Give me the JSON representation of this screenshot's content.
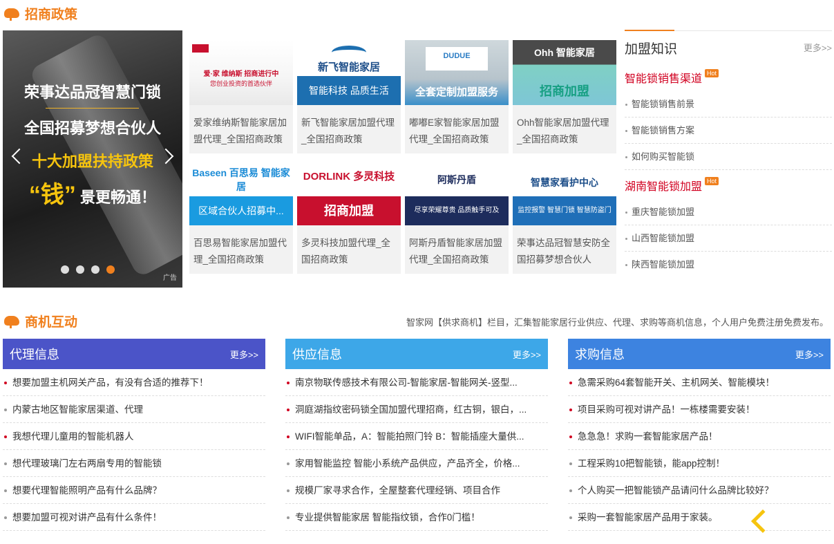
{
  "section1": {
    "title": "招商政策"
  },
  "banner": {
    "line1": "荣事达品冠智慧门锁",
    "line2": "全国招募梦想合伙人",
    "line3": "十大加盟扶持政策",
    "line4_big": "“钱”",
    "line4_rest": "景更畅通！",
    "ad": "广告",
    "dots": [
      false,
      false,
      false,
      true
    ]
  },
  "cards": [
    {
      "img_text": "爱·家 维纳斯 招商进行中",
      "img_sub": "您创业投资的首选伙伴",
      "title": "爱家维纳斯智能家居加盟代理_全国招商政策"
    },
    {
      "img_text": "新飞智能家居",
      "img_sub": "智能科技 品质生活",
      "title": "新飞智能家居加盟代理_全国招商政策"
    },
    {
      "img_text": "DUDUE",
      "img_sub": "全套定制加盟服务",
      "title": "嘟嘟E家智能家居加盟代理_全国招商政策"
    },
    {
      "img_text": "Ohh 智能家居",
      "img_sub": "招商加盟",
      "title": "Ohh智能家居加盟代理_全国招商政策"
    },
    {
      "img_text": "Baseen 百思易 智能家居",
      "img_sub": "区域合伙人招募中...",
      "title": "百思易智能家居加盟代理_全国招商政策"
    },
    {
      "img_text": "DORLINK 多灵科技",
      "img_sub": "招商加盟",
      "title": "多灵科技加盟代理_全国招商政策"
    },
    {
      "img_text": "阿斯丹盾",
      "img_sub": "尽享荣耀尊贵 品质触手可及",
      "title": "阿斯丹盾智能家居加盟代理_全国招商政策"
    },
    {
      "img_text": "智慧家看护中心",
      "img_sub": "监控报警 智慧门锁 智慧防盗门",
      "title": "荣事达品冠智慧安防全国招募梦想合伙人"
    }
  ],
  "knowledge": {
    "title": "加盟知识",
    "more": "更多>>",
    "hot": "Hot",
    "cat1": "智能锁销售渠道",
    "items1": [
      "智能锁销售前景",
      "智能锁销售方案",
      "如何购买智能锁"
    ],
    "cat2": "湖南智能锁加盟",
    "items2": [
      "重庆智能锁加盟",
      "山西智能锁加盟",
      "陕西智能锁加盟"
    ]
  },
  "section2": {
    "title": "商机互动",
    "desc": "智家网【供求商机】栏目，汇集智能家居行业供应、代理、求购等商机信息，个人用户免费注册免费发布。"
  },
  "columns": [
    {
      "title": "代理信息",
      "more": "更多>>",
      "color": "#4b54c8",
      "items": [
        "想要加盟主机网关产品，有没有合适的推荐下！",
        "内蒙古地区智能家居渠道、代理",
        "我想代理儿童用的智能机器人",
        "想代理玻璃门左右两扇专用的智能锁",
        "想要代理智能照明产品有什么品牌？",
        "想要加盟可视对讲产品有什么条件！"
      ],
      "red": [
        true,
        false,
        true,
        false,
        false,
        false
      ]
    },
    {
      "title": "供应信息",
      "more": "更多>>",
      "color": "#3da7e8",
      "items": [
        "南京物联传感技术有限公司-智能家居-智能网关-竖型...",
        "洞庭湖指纹密码锁全国加盟代理招商，红古铜，银白，...",
        "WIFI智能单品，A：智能拍照门铃 B：智能插座大量供...",
        "家用智能监控 智能小系统产品供应，产品齐全，价格...",
        "规模厂家寻求合作，全屋整套代理经销、项目合作",
        "专业提供智能家居 智能指纹锁，合作0门槛！"
      ],
      "red": [
        true,
        true,
        true,
        false,
        false,
        false
      ]
    },
    {
      "title": "求购信息",
      "more": "更多>>",
      "color": "#3d83e0",
      "items": [
        "急需采购64套智能开关、主机网关、智能模块！",
        "项目采购可视对讲产品！一栋楼需要安装！",
        "急急急！求购一套智能家居产品！",
        "工程采购10把智能锁，能app控制！",
        "个人购买一把智能锁产品请问什么品牌比较好？",
        "采购一套智能家居产品用于家装。"
      ],
      "red": [
        true,
        true,
        true,
        false,
        false,
        false
      ]
    }
  ]
}
